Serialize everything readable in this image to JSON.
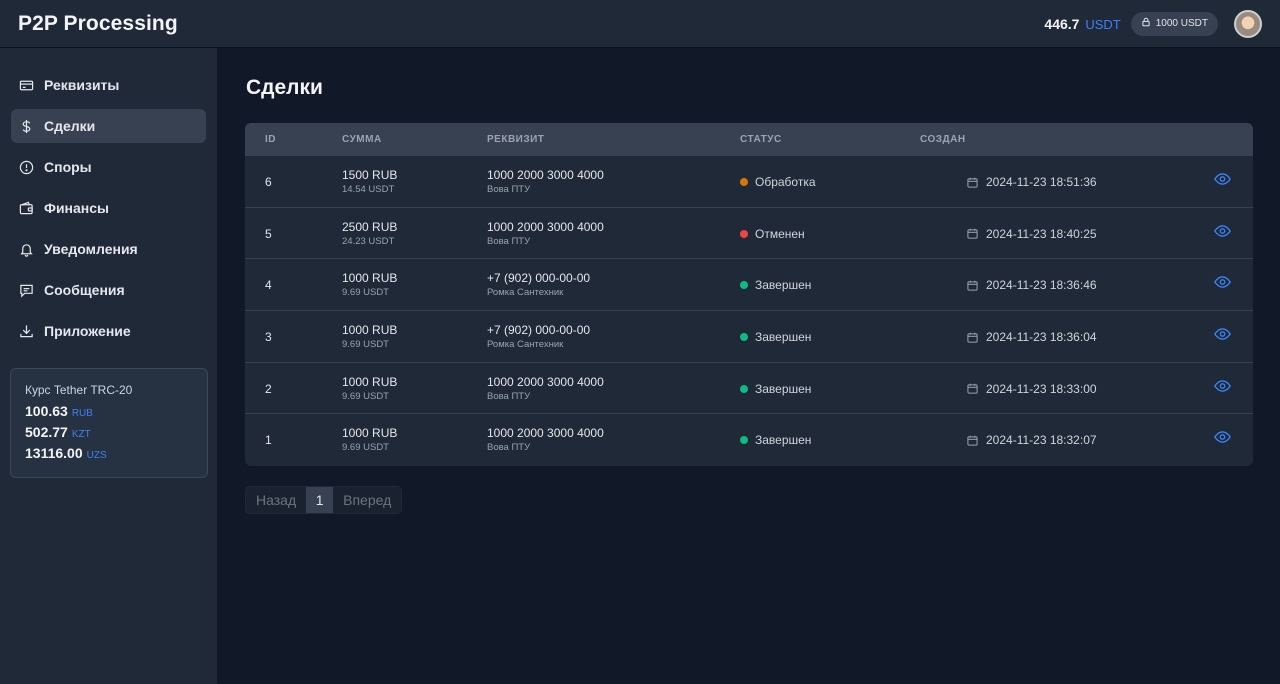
{
  "header": {
    "brand": "P2P Processing",
    "balance_value": "446.7",
    "balance_currency": "USDT",
    "locked_label": "1000 USDT"
  },
  "sidebar": {
    "items": [
      {
        "label": "Реквизиты",
        "icon": "credit-card-icon"
      },
      {
        "label": "Сделки",
        "icon": "dollar-icon"
      },
      {
        "label": "Споры",
        "icon": "alert-circle-icon"
      },
      {
        "label": "Финансы",
        "icon": "wallet-icon"
      },
      {
        "label": "Уведомления",
        "icon": "bell-icon"
      },
      {
        "label": "Сообщения",
        "icon": "message-icon"
      },
      {
        "label": "Приложение",
        "icon": "download-icon"
      }
    ],
    "active_index": 1,
    "rates": {
      "title": "Курс Tether TRC-20",
      "rows": [
        {
          "value": "100.63",
          "currency": "RUB"
        },
        {
          "value": "502.77",
          "currency": "KZT"
        },
        {
          "value": "13116.00",
          "currency": "UZS"
        }
      ]
    }
  },
  "main": {
    "title": "Сделки",
    "columns": {
      "id": "ID",
      "sum": "СУММА",
      "requisite": "РЕКВИЗИТ",
      "status": "СТАТУС",
      "created": "СОЗДАН"
    },
    "rows": [
      {
        "id": "6",
        "sum": "1500 RUB",
        "sum_usdt": "14.54 USDT",
        "req": "1000 2000 3000 4000",
        "req_name": "Вова ПТУ",
        "status": "Обработка",
        "status_color": "#d97706",
        "created": "2024-11-23 18:51:36"
      },
      {
        "id": "5",
        "sum": "2500 RUB",
        "sum_usdt": "24.23 USDT",
        "req": "1000 2000 3000 4000",
        "req_name": "Вова ПТУ",
        "status": "Отменен",
        "status_color": "#ef4444",
        "created": "2024-11-23 18:40:25"
      },
      {
        "id": "4",
        "sum": "1000 RUB",
        "sum_usdt": "9.69 USDT",
        "req": "+7 (902) 000-00-00",
        "req_name": "Ромка Сантехник",
        "status": "Завершен",
        "status_color": "#10b981",
        "created": "2024-11-23 18:36:46"
      },
      {
        "id": "3",
        "sum": "1000 RUB",
        "sum_usdt": "9.69 USDT",
        "req": "+7 (902) 000-00-00",
        "req_name": "Ромка Сантехник",
        "status": "Завершен",
        "status_color": "#10b981",
        "created": "2024-11-23 18:36:04"
      },
      {
        "id": "2",
        "sum": "1000 RUB",
        "sum_usdt": "9.69 USDT",
        "req": "1000 2000 3000 4000",
        "req_name": "Вова ПТУ",
        "status": "Завершен",
        "status_color": "#10b981",
        "created": "2024-11-23 18:33:00"
      },
      {
        "id": "1",
        "sum": "1000 RUB",
        "sum_usdt": "9.69 USDT",
        "req": "1000 2000 3000 4000",
        "req_name": "Вова ПТУ",
        "status": "Завершен",
        "status_color": "#10b981",
        "created": "2024-11-23 18:32:07"
      }
    ],
    "pagination": {
      "prev_label": "Назад",
      "current_page": "1",
      "next_label": "Вперед"
    }
  },
  "colors": {
    "accent": "#3b82f6",
    "background": "#111827",
    "panel": "#1f2937"
  }
}
